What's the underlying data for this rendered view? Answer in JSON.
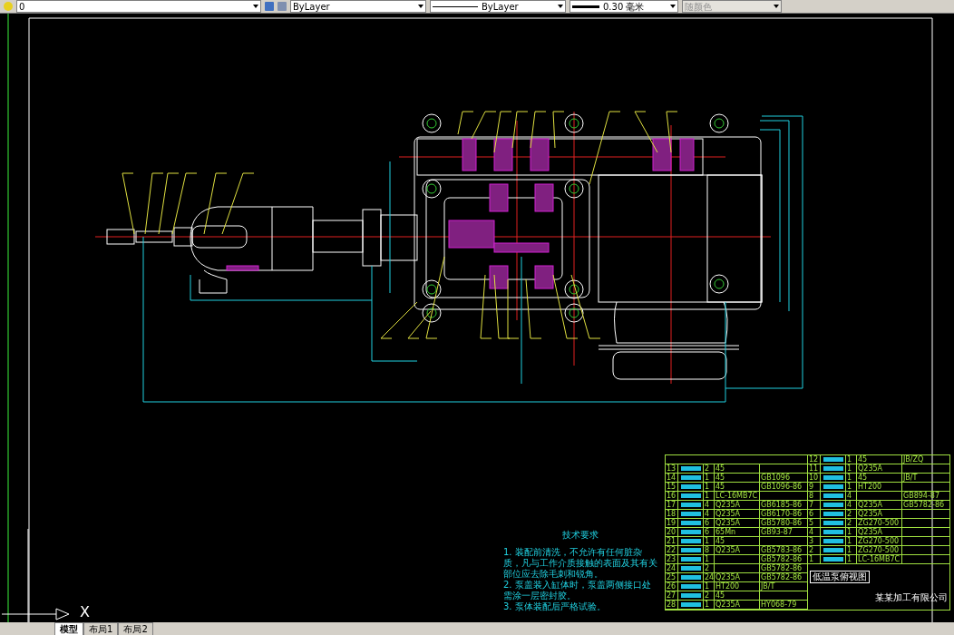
{
  "toolbar": {
    "layer": "0",
    "color_control": "ByLayer",
    "linetype": "ByLayer",
    "lineweight": "0.30 毫米",
    "plot_style": "随颜色",
    "plot_style_disabled": true
  },
  "technical_requirements": {
    "title": "技术要求",
    "items": [
      "1. 装配前清洗，不允许有任何脏杂质，凡与工作介质接触的表面及其有关部位应去除毛刺和锐角。",
      "2. 泵盖装入缸体时，泵盖两侧接口处需涂一层密封胶。",
      "3. 泵体装配后严格试验。"
    ]
  },
  "parts_list": {
    "left_rows": [
      {
        "no": "13",
        "qty": "2",
        "material": "45"
      },
      {
        "no": "14",
        "qty": "1",
        "material": "45",
        "standard": "GB1096"
      },
      {
        "no": "15",
        "qty": "1",
        "material": "45",
        "standard": "GB1096-86"
      },
      {
        "no": "16",
        "qty": "1",
        "material": "LC-16MB7C"
      },
      {
        "no": "17",
        "qty": "4",
        "material": "Q235A",
        "standard": "GB6185-86"
      },
      {
        "no": "18",
        "qty": "4",
        "material": "Q235A",
        "standard": "GB6170-86"
      },
      {
        "no": "19",
        "qty": "6",
        "material": "Q235A",
        "standard": "GB5780-86"
      },
      {
        "no": "20",
        "qty": "6",
        "material": "65Mn",
        "standard": "GB93-87"
      },
      {
        "no": "21",
        "qty": "1",
        "material": "45"
      },
      {
        "no": "22",
        "qty": "8",
        "material": "Q235A",
        "standard": "GB5783-86"
      },
      {
        "no": "23",
        "qty": "1",
        "standard": "GB5782-86"
      },
      {
        "no": "24",
        "qty": "2",
        "standard": "GB5782-86"
      },
      {
        "no": "25",
        "qty": "24",
        "material": "Q235A",
        "standard": "GB5782-86"
      },
      {
        "no": "26",
        "qty": "1",
        "material": "HT200",
        "standard": "JB/T"
      },
      {
        "no": "27",
        "qty": "2",
        "material": "45"
      },
      {
        "no": "28",
        "qty": "1",
        "material": "Q235A",
        "standard": "HY068-79"
      }
    ],
    "right_rows": [
      {
        "no": "12",
        "qty": "1",
        "material": "45",
        "standard": "JB/ZQ"
      },
      {
        "no": "11",
        "qty": "1",
        "material": "Q235A"
      },
      {
        "no": "10",
        "qty": "1",
        "material": "45",
        "standard": "JB/T"
      },
      {
        "no": "9",
        "qty": "1",
        "material": "HT200"
      },
      {
        "no": "8",
        "qty": "4",
        "standard": "GB894-87"
      },
      {
        "no": "7",
        "qty": "4",
        "material": "Q235A",
        "standard": "GB5782-86"
      },
      {
        "no": "6",
        "qty": "2",
        "material": "Q235A"
      },
      {
        "no": "5",
        "qty": "2",
        "material": "ZG270-500"
      },
      {
        "no": "4",
        "qty": "1",
        "material": "Q235A"
      },
      {
        "no": "3",
        "qty": "1",
        "material": "ZG270-500"
      },
      {
        "no": "2",
        "qty": "1",
        "material": "ZG270-500"
      },
      {
        "no": "1",
        "qty": "1",
        "material": "LC-16MB7C"
      }
    ]
  },
  "title_block": {
    "drawing_title": "低温泵俯视图",
    "company": "某某加工有限公司"
  },
  "ucs": {
    "x_label": "X"
  },
  "layout_tabs": [
    {
      "label": "模型",
      "selected": true
    },
    {
      "label": "布局1",
      "selected": false
    },
    {
      "label": "布局2",
      "selected": false
    }
  ]
}
